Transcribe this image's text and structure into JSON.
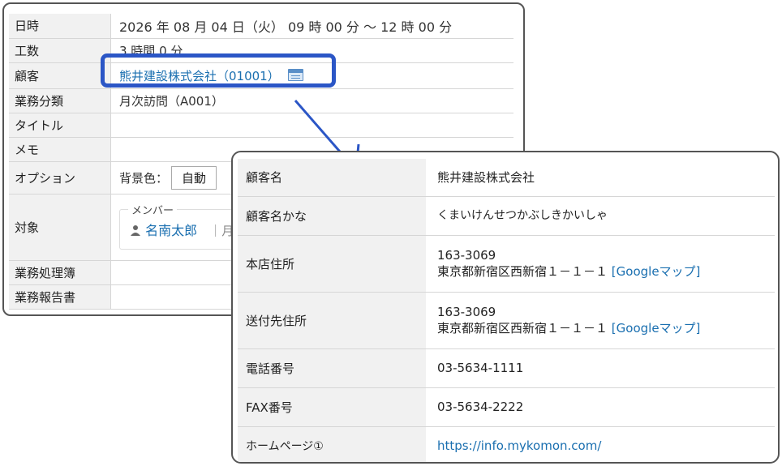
{
  "back_form": {
    "rows": [
      {
        "label": "日時",
        "value": "2026 年 08 月 04 日（火） 09 時 00 分 ～ 12 時 00 分"
      },
      {
        "label": "工数",
        "value": "3 時間 0 分"
      },
      {
        "label": "顧客",
        "value": "熊井建設株式会社（01001）"
      },
      {
        "label": "業務分類",
        "value": "月次訪問（A001）"
      },
      {
        "label": "タイトル",
        "value": ""
      },
      {
        "label": "メモ",
        "value": ""
      },
      {
        "label": "オプション",
        "bg_label": "背景色：",
        "bg_value": "自動"
      },
      {
        "label": "対象",
        "member_legend": "メンバー",
        "member_name": "名南太郎",
        "member_sep": "｜月"
      },
      {
        "label": "業務処理簿",
        "value": ""
      },
      {
        "label": "業務報告書",
        "value": ""
      }
    ]
  },
  "customer_popup": {
    "rows": [
      {
        "label": "顧客名",
        "value": "熊井建設株式会社"
      },
      {
        "label": "顧客名かな",
        "value": "くまいけんせつかぶしきかいしゃ"
      },
      {
        "label": "本店住所",
        "postal": "163-3069",
        "address": "東京都新宿区西新宿１－１－１",
        "map_link": "[Googleマップ]"
      },
      {
        "label": "送付先住所",
        "postal": "163-3069",
        "address": "東京都新宿区西新宿１－１－１",
        "map_link": "[Googleマップ]"
      },
      {
        "label": "電話番号",
        "value": "03-5634-1111"
      },
      {
        "label": "FAX番号",
        "value": "03-5634-2222"
      },
      {
        "label": "ホームページ①",
        "value": "https://info.mykomon.com/"
      }
    ]
  },
  "colors": {
    "highlight": "#2b56c6",
    "link": "#1a6fb0",
    "label_bg": "#f1f1f1"
  },
  "icons": {
    "customer_calendar": "calendar-icon",
    "member": "person-icon"
  }
}
